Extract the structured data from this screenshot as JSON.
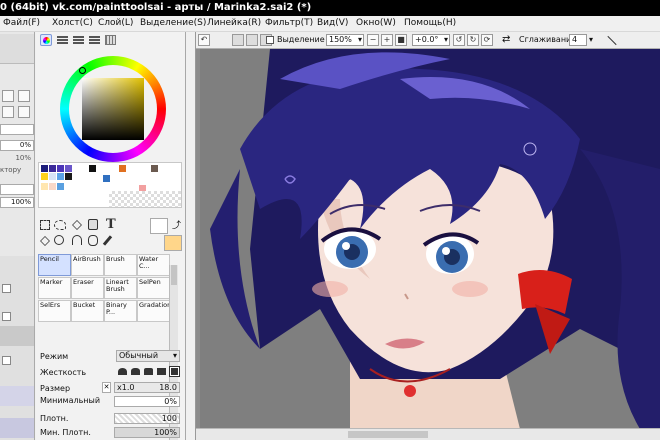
{
  "window": {
    "title": "0 (64bit) vk.com/painttoolsai - арты / Marinka2.sai2 (*)"
  },
  "menu": [
    "Файл(F)",
    "Холст(C)",
    "Слой(L)",
    "Выделение(S)",
    "Линейка(R)",
    "Фильтр(T)",
    "Вид(V)",
    "Окно(W)",
    "Помощь(H)"
  ],
  "toolbar": {
    "selection_label": "Выделение",
    "zoom": "150%",
    "rotation": "+0.0°",
    "smoothing_label": "Сглаживание",
    "smoothing_value": "4"
  },
  "left_panel": {
    "values": [
      "0%",
      "10%",
      "ктору",
      "100%"
    ]
  },
  "color_panel": {
    "swatches_row1": [
      "#1c1c7a",
      "#3b2a9a",
      "#4c35b8",
      "#6a56c9"
    ],
    "swatches_row2": [
      "#ffd21c",
      "#d6e4f7",
      "#5ca4e8",
      "#1a1a1a"
    ],
    "current_color": "#ffd68a",
    "secondary_color": "#ffffff"
  },
  "tools": [
    {
      "label": "Pencil",
      "selected": true
    },
    {
      "label": "AirBrush",
      "selected": false
    },
    {
      "label": "Brush",
      "selected": false
    },
    {
      "label": "Water C...",
      "selected": false
    },
    {
      "label": "Marker",
      "selected": false
    },
    {
      "label": "Eraser",
      "selected": false
    },
    {
      "label": "Lineart Brush",
      "selected": false
    },
    {
      "label": "SelPen",
      "selected": false
    },
    {
      "label": "SelErs",
      "selected": false
    },
    {
      "label": "Bucket",
      "selected": false
    },
    {
      "label": "Binary P...",
      "selected": false
    },
    {
      "label": "Gradation",
      "selected": false
    }
  ],
  "settings": {
    "mode_label": "Режим",
    "mode_value": "Обычный",
    "hardness_label": "Жесткость",
    "size_label": "Размер",
    "size_multiplier": "x1.0",
    "size_value": "18.0",
    "min_label": "Минимальный",
    "min_value": "0%",
    "density_label": "Плотн.",
    "density_value": "100",
    "min_density_label": "Мин. Плотн.",
    "min_density_value": "100%"
  },
  "layers_side": {
    "values": [
      "0%",
      "10%",
      "100%"
    ]
  }
}
